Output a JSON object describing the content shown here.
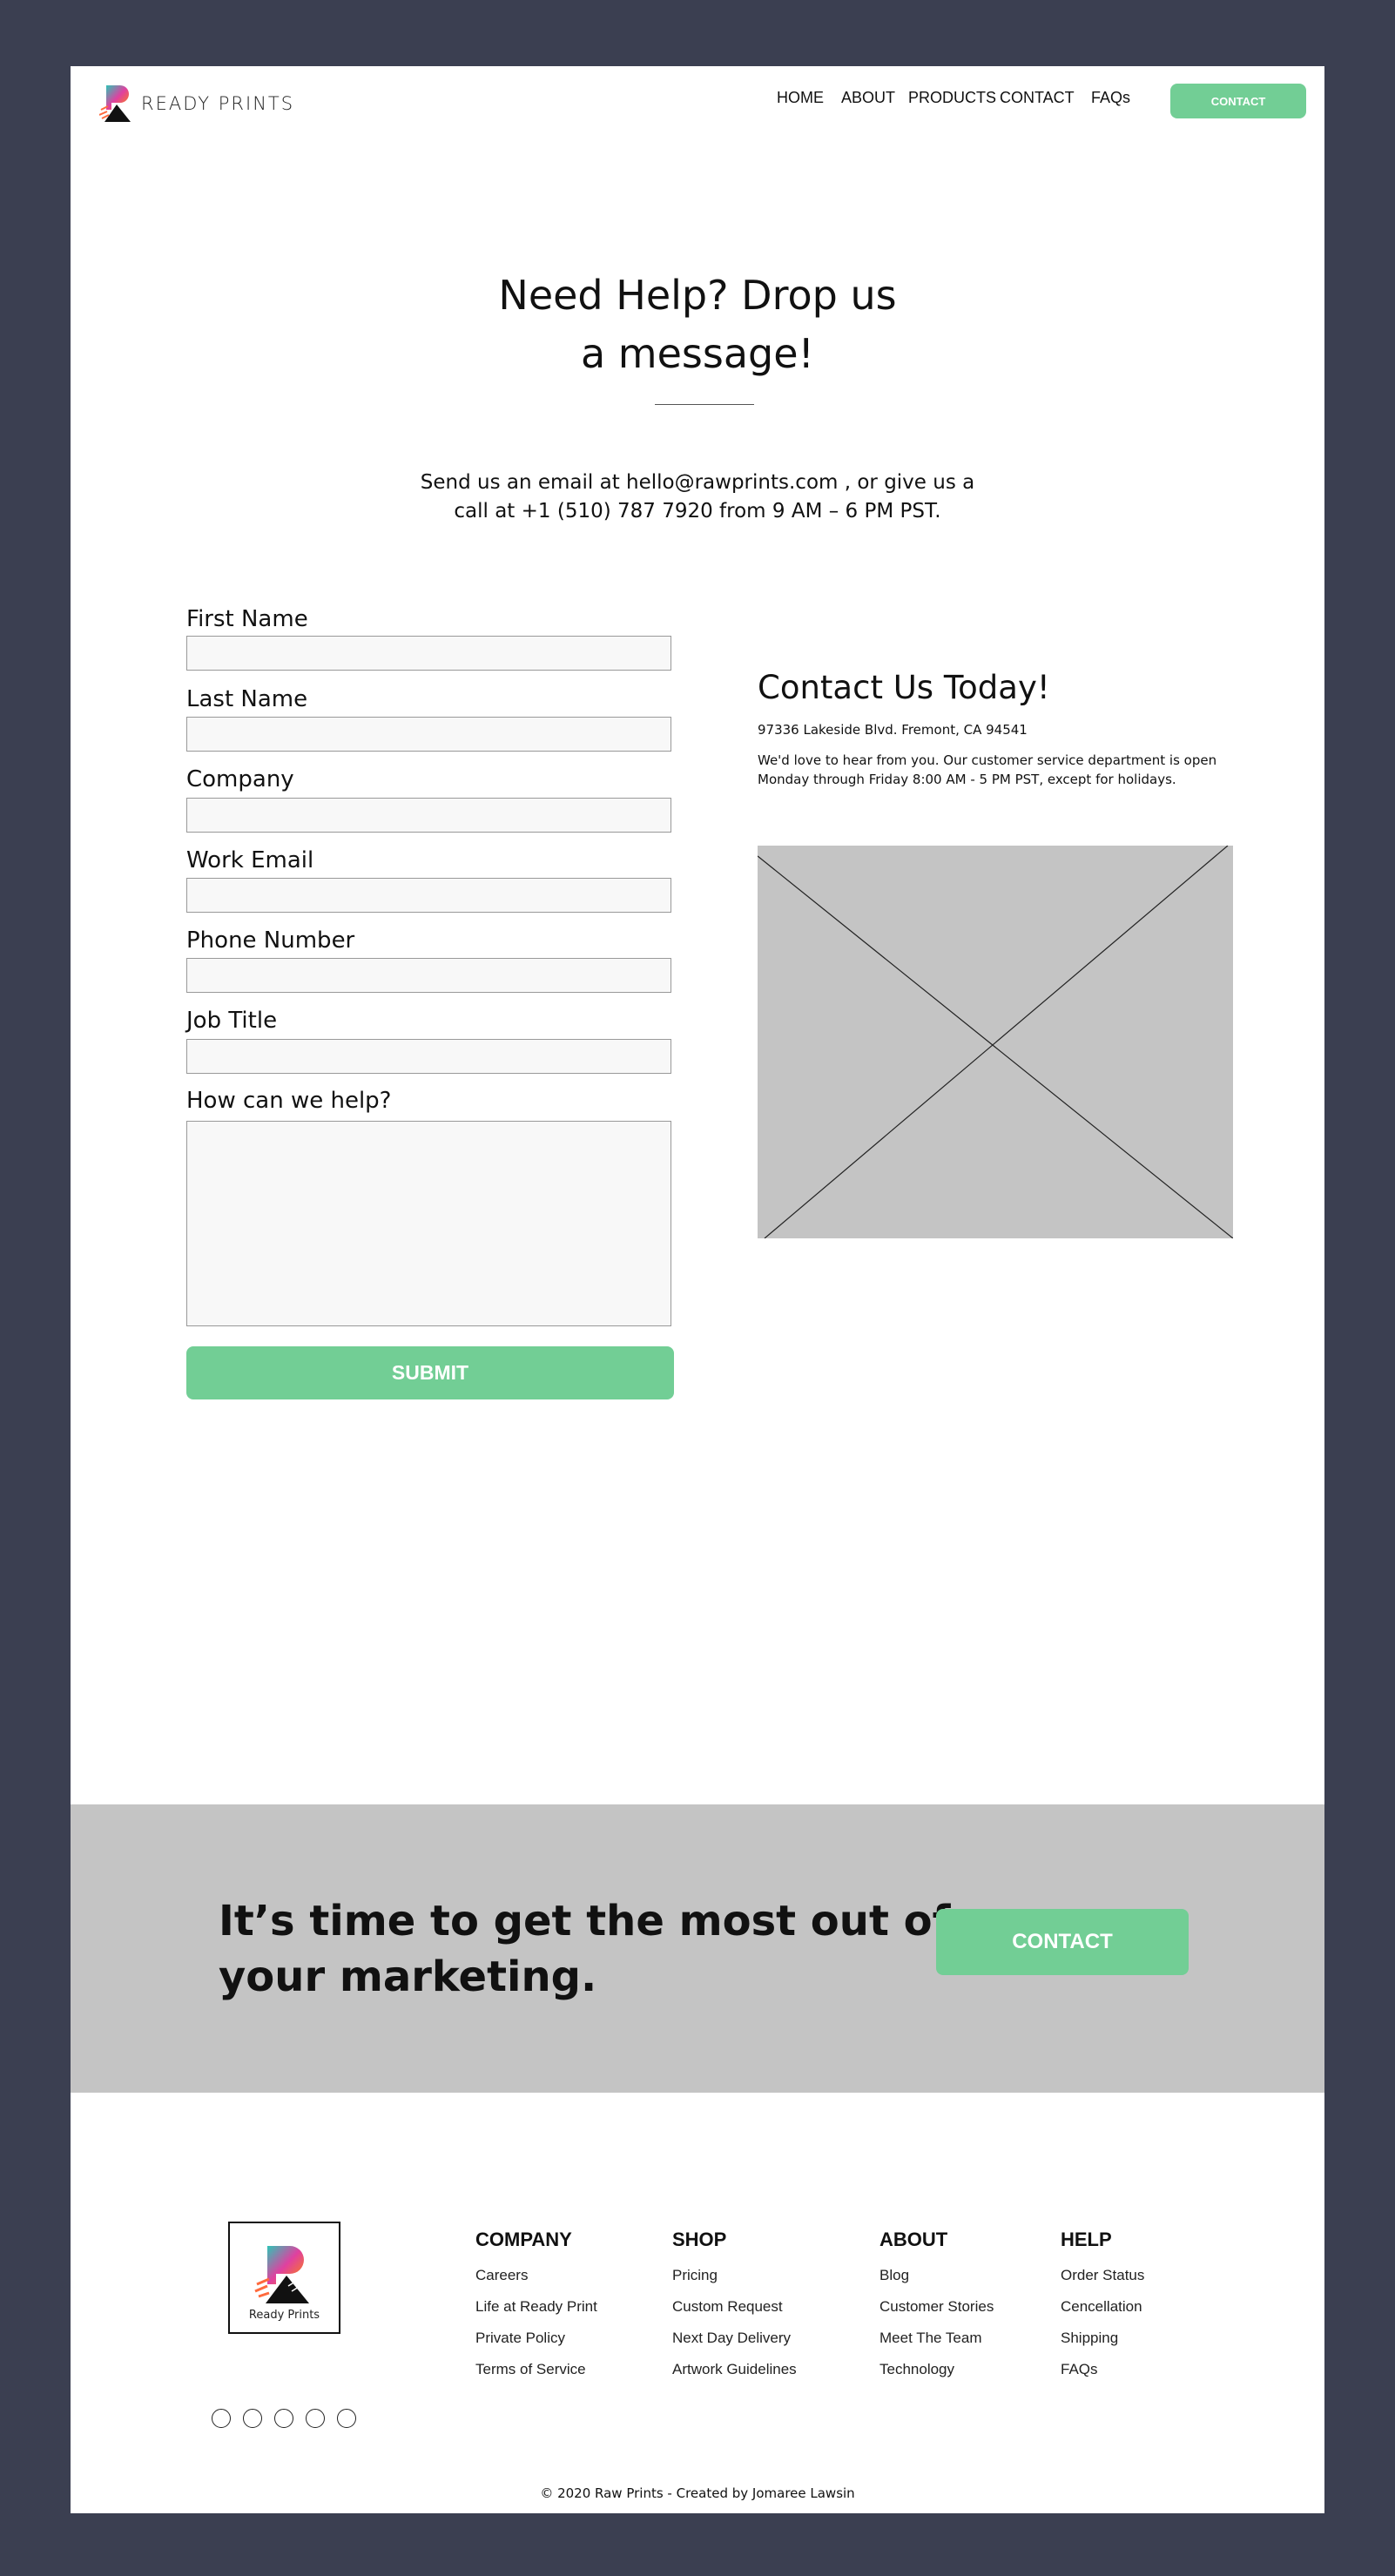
{
  "header": {
    "brand": "READY PRINTS",
    "nav": [
      "HOME",
      "ABOUT",
      "PRODUCTS",
      "CONTACT",
      "FAQs"
    ],
    "cta": "CONTACT"
  },
  "hero": {
    "title_lines": [
      "Need Help? Drop us",
      "a message!"
    ],
    "subtitle_lines": [
      "Send us an email at hello@rawprints.com , or give us a",
      "call at +1 (510) 787 7920 from 9 AM – 6 PM PST."
    ]
  },
  "form": {
    "fields": [
      {
        "label": "First Name",
        "value": ""
      },
      {
        "label": "Last Name",
        "value": ""
      },
      {
        "label": "Company",
        "value": ""
      },
      {
        "label": "Work Email",
        "value": ""
      },
      {
        "label": "Phone Number",
        "value": ""
      },
      {
        "label": "Job Title",
        "value": ""
      },
      {
        "label": "How can we help?",
        "value": ""
      }
    ],
    "submit": "SUBMIT"
  },
  "contact_info": {
    "title": "Contact Us Today!",
    "address": "97336 Lakeside Blvd. Fremont, CA 94541",
    "description_lines": [
      "We'd love to hear from you. Our customer service department is open",
      "Monday through Friday 8:00 AM - 5 PM PST, except for holidays."
    ]
  },
  "banner": {
    "text_lines": [
      "It’s time to get the most out of",
      "your marketing."
    ],
    "cta": "CONTACT"
  },
  "footer": {
    "logo_text": "Ready Prints",
    "columns": [
      {
        "title": "COMPANY",
        "links": [
          "Careers",
          "Life at Ready Print",
          "Private Policy",
          "Terms of Service"
        ]
      },
      {
        "title": "SHOP",
        "links": [
          "Pricing",
          "Custom Request",
          "Next Day Delivery",
          "Artwork Guidelines"
        ]
      },
      {
        "title": "ABOUT",
        "links": [
          "Blog",
          "Customer Stories",
          "Meet The Team",
          "Technology"
        ]
      },
      {
        "title": "HELP",
        "links": [
          "Order Status",
          "Cencellation",
          "Shipping",
          "FAQs"
        ]
      }
    ],
    "social_icons": [
      "social-icon-1",
      "social-icon-2",
      "social-icon-3",
      "social-icon-4",
      "social-icon-5"
    ],
    "copyright": "© 2020 Raw Prints - Created by Jomaree Lawsin"
  },
  "colors": {
    "background": "#3b3f51",
    "accent": "#72ce95",
    "placeholder_gray": "#c4c4c4"
  }
}
